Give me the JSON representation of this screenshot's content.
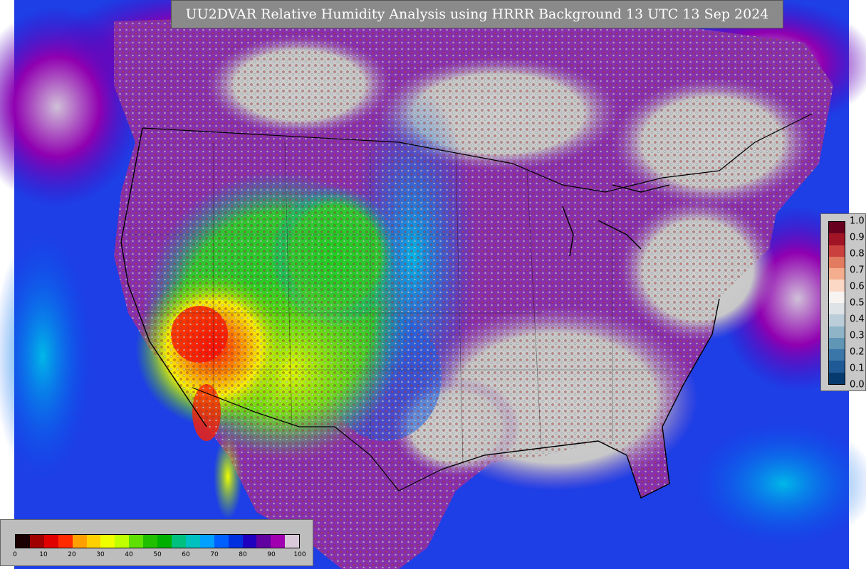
{
  "title": "UU2DVAR Relative Humidity Analysis using HRRR Background 13 UTC 13 Sep 2024",
  "rh_colorbar": {
    "tick_labels": [
      "0",
      "10",
      "20",
      "30",
      "40",
      "50",
      "60",
      "70",
      "80",
      "90",
      "100"
    ],
    "colors": [
      "#1a0000",
      "#a00000",
      "#e00000",
      "#ff2a00",
      "#ffa000",
      "#ffd000",
      "#f0ff00",
      "#c0ff00",
      "#60e000",
      "#20c000",
      "#00b000",
      "#00c080",
      "#00c0c0",
      "#00a0ff",
      "#0060ff",
      "#0030e0",
      "#2000c0",
      "#6000a0",
      "#a000b0",
      "#d8c8d8"
    ]
  },
  "error_colorbar": {
    "tick_labels": [
      "1.0",
      "0.9",
      "0.8",
      "0.7",
      "0.6",
      "0.5",
      "0.4",
      "0.3",
      "0.2",
      "0.1",
      "0.0"
    ],
    "colors": [
      "#67001f",
      "#a01426",
      "#c9403f",
      "#e27b60",
      "#f4ae8d",
      "#fbd8c6",
      "#f7f3f0",
      "#dde3e6",
      "#bacdd8",
      "#8fb4c8",
      "#5f95b5",
      "#3b76a8",
      "#1f5a96",
      "#073b6f"
    ]
  },
  "map": {
    "ocean_color": "#1838e0",
    "land_dry_color": "#ff2000",
    "land_moist_color": "#10c810",
    "land_wet_color": "#c8c8c8"
  }
}
